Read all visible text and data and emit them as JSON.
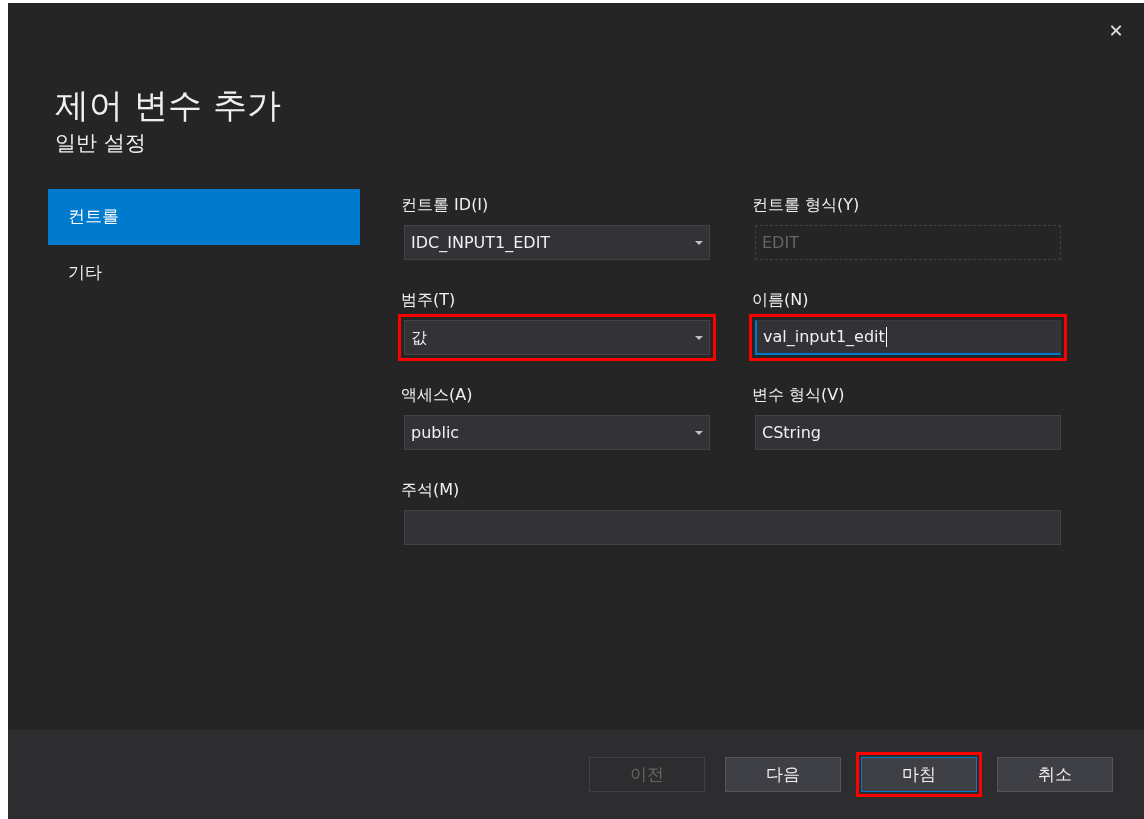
{
  "dialog": {
    "title": "제어 변수 추가",
    "subtitle": "일반 설정",
    "close": "✕"
  },
  "sidebar": {
    "items": [
      {
        "label": "컨트롤",
        "selected": true
      },
      {
        "label": "기타",
        "selected": false
      }
    ]
  },
  "fields": [
    {
      "label": "컨트롤 ID(I)",
      "kind": "dropdown",
      "value": "IDC_INPUT1_EDIT",
      "disabled": false,
      "focused": false,
      "highlighted": false
    },
    {
      "label": "컨트롤 형식(Y)",
      "kind": "text",
      "value": "EDIT",
      "disabled": true,
      "focused": false,
      "highlighted": false
    },
    {
      "label": "범주(T)",
      "kind": "dropdown",
      "value": "값",
      "disabled": false,
      "focused": false,
      "highlighted": true
    },
    {
      "label": "이름(N)",
      "kind": "text",
      "value": "val_input1_edit",
      "disabled": false,
      "focused": true,
      "highlighted": true
    },
    {
      "label": "액세스(A)",
      "kind": "dropdown",
      "value": "public",
      "disabled": false,
      "focused": false,
      "highlighted": false
    },
    {
      "label": "변수 형식(V)",
      "kind": "text",
      "value": "CString",
      "disabled": false,
      "focused": false,
      "highlighted": false
    },
    {
      "label": "주석(M)",
      "kind": "wide",
      "disabled": false,
      "focused": false,
      "highlighted": false
    }
  ],
  "buttons": [
    {
      "label": "이전",
      "disabled": true,
      "focused": false,
      "highlighted": false
    },
    {
      "label": "다음",
      "disabled": false,
      "focused": false,
      "highlighted": false
    },
    {
      "label": "마침",
      "disabled": false,
      "focused": true,
      "highlighted": true
    },
    {
      "label": "취소",
      "disabled": false,
      "focused": false,
      "highlighted": false
    }
  ]
}
